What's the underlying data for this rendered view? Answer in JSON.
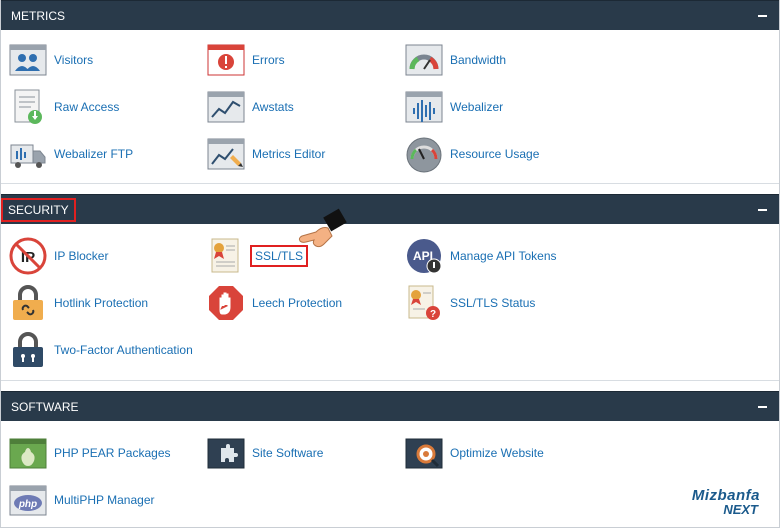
{
  "sections": {
    "metrics": {
      "title": "METRICS",
      "items": [
        {
          "label": "Visitors",
          "icon": "visitors-icon"
        },
        {
          "label": "Errors",
          "icon": "errors-icon"
        },
        {
          "label": "Bandwidth",
          "icon": "bandwidth-icon"
        },
        {
          "label": "Raw Access",
          "icon": "raw-access-icon"
        },
        {
          "label": "Awstats",
          "icon": "awstats-icon"
        },
        {
          "label": "Webalizer",
          "icon": "webalizer-icon"
        },
        {
          "label": "Webalizer FTP",
          "icon": "webalizer-ftp-icon"
        },
        {
          "label": "Metrics Editor",
          "icon": "metrics-editor-icon"
        },
        {
          "label": "Resource Usage",
          "icon": "resource-usage-icon"
        }
      ]
    },
    "security": {
      "title": "SECURITY",
      "items": [
        {
          "label": "IP Blocker",
          "icon": "ip-blocker-icon"
        },
        {
          "label": "SSL/TLS",
          "icon": "ssl-certificate-icon"
        },
        {
          "label": "Manage API Tokens",
          "icon": "api-tokens-icon"
        },
        {
          "label": "Hotlink Protection",
          "icon": "hotlink-lock-icon"
        },
        {
          "label": "Leech Protection",
          "icon": "leech-hand-icon"
        },
        {
          "label": "SSL/TLS Status",
          "icon": "ssl-status-icon"
        },
        {
          "label": "Two-Factor Authentication",
          "icon": "two-factor-lock-icon"
        }
      ]
    },
    "software": {
      "title": "SOFTWARE",
      "items": [
        {
          "label": "PHP PEAR Packages",
          "icon": "php-pear-icon"
        },
        {
          "label": "Site Software",
          "icon": "site-software-icon"
        },
        {
          "label": "Optimize Website",
          "icon": "optimize-website-icon"
        },
        {
          "label": "MultiPHP Manager",
          "icon": "multiphp-icon"
        }
      ]
    }
  },
  "logo": {
    "line1": "Mizbanfa",
    "line2": "NEXT"
  },
  "colors": {
    "header_bg": "#293a4a",
    "link": "#1a6fb3",
    "highlight": "#e02020"
  }
}
